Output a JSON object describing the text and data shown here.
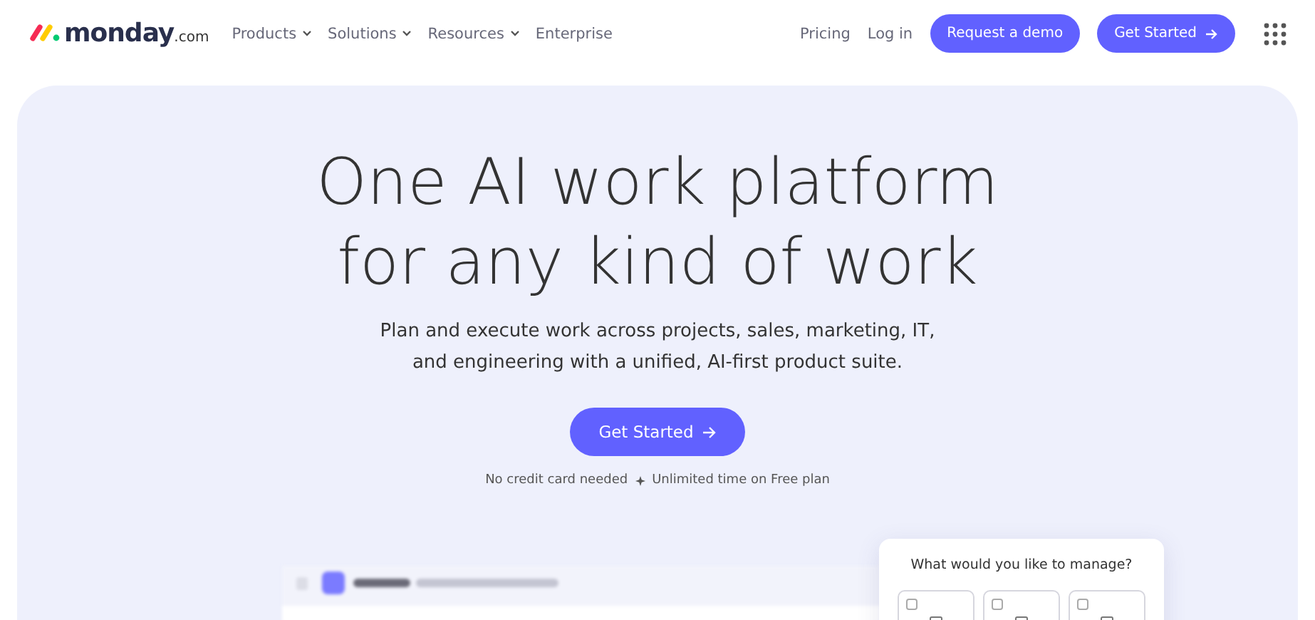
{
  "nav": {
    "logo": {
      "name": "monday",
      "suffix": ".com"
    },
    "menu": [
      {
        "label": "Products",
        "dropdown": true
      },
      {
        "label": "Solutions",
        "dropdown": true
      },
      {
        "label": "Resources",
        "dropdown": true
      },
      {
        "label": "Enterprise",
        "dropdown": false
      }
    ],
    "links": [
      "Pricing",
      "Log in"
    ],
    "demo_button": "Request a demo",
    "cta_button": "Get Started"
  },
  "hero": {
    "title_lines": [
      "One AI work platform",
      "for any kind of work"
    ],
    "subtitle_lines": [
      "Plan and execute work across projects, sales, marketing, IT,",
      "and engineering with a unified, AI-first product suite."
    ],
    "cta_button": "Get Started",
    "note": [
      "No credit card needed",
      "Unlimited time on Free plan"
    ]
  },
  "manage_card": {
    "title": "What would you like to manage?",
    "options": [
      {
        "checked": false
      },
      {
        "checked": false
      },
      {
        "checked": false
      }
    ]
  }
}
